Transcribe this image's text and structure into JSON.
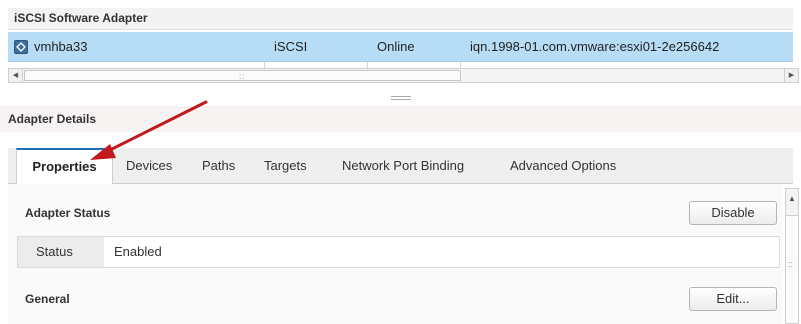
{
  "adapters": {
    "group_title": "iSCSI Software Adapter",
    "rows": [
      {
        "name": "vmhba33",
        "type": "iSCSI",
        "status": "Online",
        "identifier": "iqn.1998-01.com.vmware:esxi01-2e256642"
      }
    ]
  },
  "details": {
    "title": "Adapter Details",
    "tabs": [
      "Properties",
      "Devices",
      "Paths",
      "Targets",
      "Network Port Binding",
      "Advanced Options"
    ],
    "active_tab": "Properties",
    "adapter_status": {
      "title": "Adapter Status",
      "action": "Disable",
      "status_label": "Status",
      "status_value": "Enabled"
    },
    "general": {
      "title": "General",
      "action": "Edit..."
    }
  },
  "colors": {
    "selected_row": "#b7ddf6",
    "accent": "#1e6fb5",
    "annotation_arrow": "#c0191e"
  },
  "icons": [
    "adapter-icon",
    "scroll-left-icon",
    "scroll-right-icon",
    "scroll-up-icon",
    "splitter-icon",
    "annotation-arrow"
  ]
}
